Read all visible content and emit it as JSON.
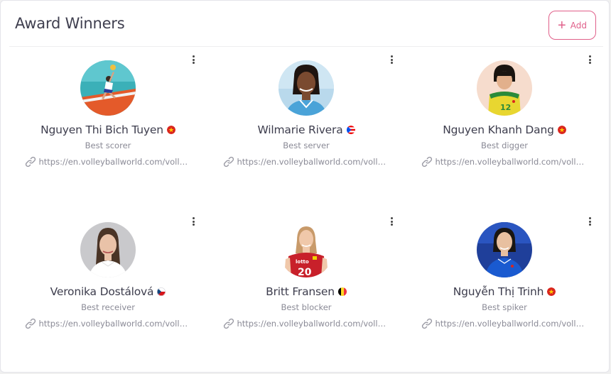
{
  "header": {
    "title": "Award Winners",
    "add_label": "Add"
  },
  "colors": {
    "accent": "#e0608a",
    "text": "#3d3d4d",
    "muted": "#8a8a96"
  },
  "winners": [
    {
      "name": "Nguyen Thi Bich Tuyen",
      "award": "Best scorer",
      "url": "https://en.volleyballworld.com/volleyball/competitions",
      "flag": "vietnam-flag",
      "avatar": "action-spike-photo"
    },
    {
      "name": "Wilmarie Rivera",
      "award": "Best server",
      "url": "https://en.volleyballworld.com/volleyball/competitions",
      "flag": "puerto-rico-flag",
      "avatar": "player-portrait-photo"
    },
    {
      "name": "Nguyen Khanh Dang",
      "award": "Best digger",
      "url": "https://en.volleyballworld.com/volleyball/competitions",
      "flag": "vietnam-flag",
      "avatar": "player-portrait-photo"
    },
    {
      "name": "Veronika Dostálová",
      "award": "Best receiver",
      "url": "https://en.volleyballworld.com/volleyball/competitions",
      "flag": "czech-flag",
      "avatar": "player-portrait-photo"
    },
    {
      "name": "Britt Fransen",
      "award": "Best blocker",
      "url": "https://en.volleyballworld.com/volleyball/competitions",
      "flag": "belgium-flag",
      "avatar": "player-portrait-photo"
    },
    {
      "name": "Nguyễn Thị Trinh",
      "award": "Best spiker",
      "url": "https://en.volleyballworld.com/volleyball/competitions",
      "flag": "vietnam-flag",
      "avatar": "player-portrait-photo"
    }
  ]
}
